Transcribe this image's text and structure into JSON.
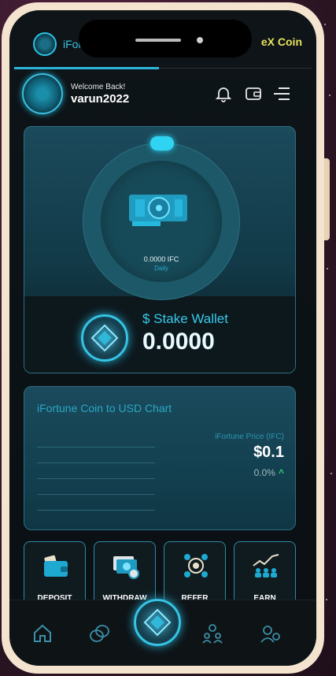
{
  "top_tabs": {
    "left_label": "iFortune",
    "right_label": "eX Coin"
  },
  "header": {
    "welcome": "Welcome Back!",
    "username": "varun2022"
  },
  "stake": {
    "ifc_amount": "0.0000 IFC",
    "ifc_period": "Daily",
    "title": "$ Stake Wallet",
    "value": "0.0000"
  },
  "chart": {
    "title": "iFortune Coin to USD Chart",
    "price_label": "iFortune Price (IFC)",
    "price_value": "$0.1",
    "change": "0.0%"
  },
  "actions": [
    {
      "label": "DEPOSIT",
      "icon": "wallet-icon"
    },
    {
      "label": "WITHDRAW",
      "icon": "cash-icon"
    },
    {
      "label": "REFER",
      "icon": "network-icon"
    },
    {
      "label": "EARN",
      "icon": "growth-icon"
    }
  ],
  "nav": {
    "items": [
      "home-icon",
      "coins-icon",
      "stake-center-icon",
      "users-icon",
      "settings-icon"
    ]
  },
  "colors": {
    "accent": "#2bb5d9",
    "gold": "#e7e25a",
    "up": "#34d36b"
  }
}
